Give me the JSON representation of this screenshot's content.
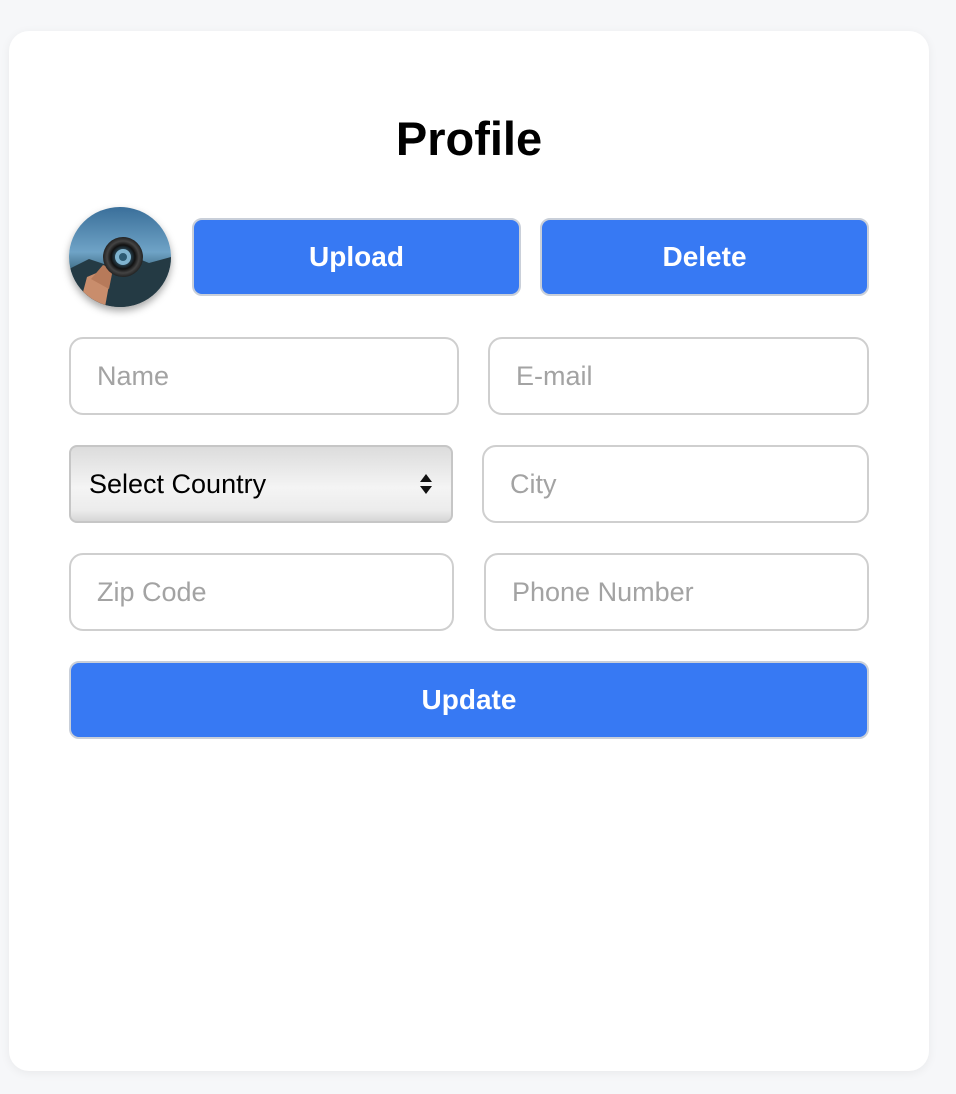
{
  "profile": {
    "title": "Profile",
    "avatar_icon": "camera-lens-photo",
    "upload_label": "Upload",
    "delete_label": "Delete",
    "fields": {
      "name_placeholder": "Name",
      "email_placeholder": "E-mail",
      "country_selected": "Select Country",
      "city_placeholder": "City",
      "zip_placeholder": "Zip Code",
      "phone_placeholder": "Phone Number"
    },
    "update_label": "Update"
  },
  "colors": {
    "accent": "#3779f3",
    "background": "#f6f7f9",
    "card": "#ffffff",
    "placeholder": "#a3a3a3"
  }
}
